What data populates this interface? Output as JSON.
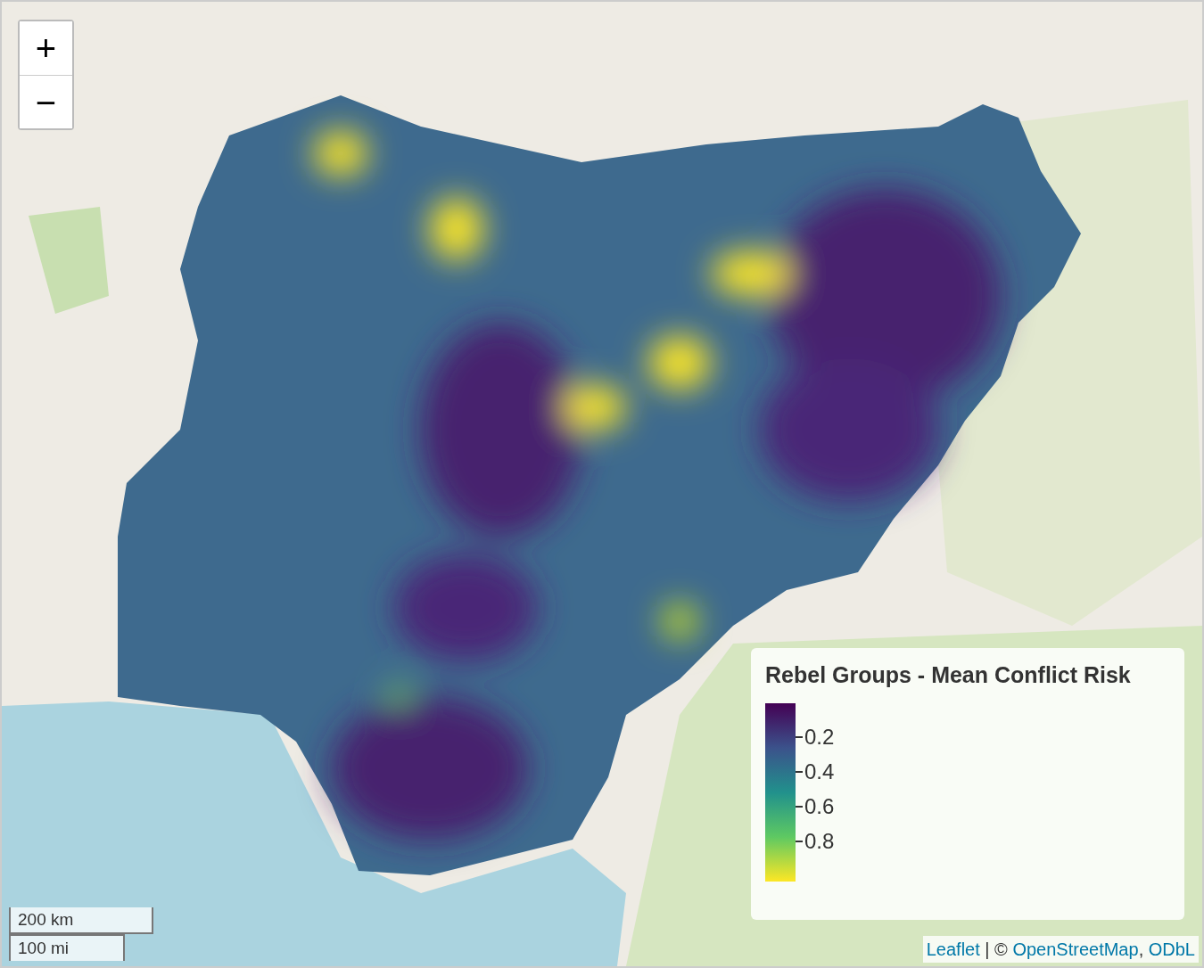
{
  "zoom_controls": [
    "+",
    "−"
  ],
  "legend": {
    "title": "Rebel Groups - Mean Conflict Risk",
    "ticks": [
      "0.2",
      "0.4",
      "0.6",
      "0.8"
    ]
  },
  "scale_bar": [
    "200 km",
    "100 mi"
  ],
  "attribution": [
    {
      "text": "Leaflet",
      "kind": "link"
    },
    {
      "text": " | © ",
      "kind": "text"
    },
    {
      "text": "OpenStreetMap",
      "kind": "link"
    },
    {
      "text": ", ",
      "kind": "text"
    },
    {
      "text": "ODbL",
      "kind": "link"
    }
  ]
}
